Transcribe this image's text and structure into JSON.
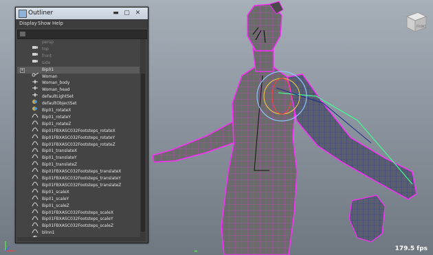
{
  "viewport": {
    "fps_text": "179.5 fps",
    "viewcube_label": "FRONT"
  },
  "outliner": {
    "title": "Outliner",
    "buttons": {
      "minimize": "▬",
      "maximize": "▢",
      "close": "✕"
    },
    "menu": [
      "Display",
      "Show",
      "Help"
    ],
    "items": [
      {
        "label": "persp",
        "icon": "camera-icon",
        "dim": true
      },
      {
        "label": "top",
        "icon": "camera-icon",
        "dim": true
      },
      {
        "label": "front",
        "icon": "camera-icon",
        "dim": true
      },
      {
        "label": "side",
        "icon": "camera-icon",
        "dim": true
      },
      {
        "label": "Bip01",
        "icon": "joint-icon",
        "selected": true,
        "expand": "+"
      },
      {
        "label": "Woman",
        "icon": "transform-icon"
      },
      {
        "label": "Woman_body",
        "icon": "transform-icon"
      },
      {
        "label": "Woman_head",
        "icon": "transform-icon"
      },
      {
        "label": "defaultLightSet",
        "icon": "set-icon"
      },
      {
        "label": "defaultObjectSet",
        "icon": "set-icon"
      },
      {
        "label": "Bip01_rotateX",
        "icon": "animcurve-icon"
      },
      {
        "label": "Bip01_rotateY",
        "icon": "animcurve-icon"
      },
      {
        "label": "Bip01_rotateZ",
        "icon": "animcurve-icon"
      },
      {
        "label": "Bip01FBXASC032Footsteps_rotateX",
        "icon": "animcurve-icon"
      },
      {
        "label": "Bip01FBXASC032Footsteps_rotateY",
        "icon": "animcurve-icon"
      },
      {
        "label": "Bip01FBXASC032Footsteps_rotateZ",
        "icon": "animcurve-icon"
      },
      {
        "label": "Bip01_translateX",
        "icon": "animcurve-icon"
      },
      {
        "label": "Bip01_translateY",
        "icon": "animcurve-icon"
      },
      {
        "label": "Bip01_translateZ",
        "icon": "animcurve-icon"
      },
      {
        "label": "Bip01FBXASC032Footsteps_translateX",
        "icon": "animcurve-icon"
      },
      {
        "label": "Bip01FBXASC032Footsteps_translateY",
        "icon": "animcurve-icon"
      },
      {
        "label": "Bip01FBXASC032Footsteps_translateZ",
        "icon": "animcurve-icon"
      },
      {
        "label": "Bip01_scaleX",
        "icon": "animcurve-icon"
      },
      {
        "label": "Bip01_scaleY",
        "icon": "animcurve-icon"
      },
      {
        "label": "Bip01_scaleZ",
        "icon": "animcurve-icon"
      },
      {
        "label": "Bip01FBXASC032Footsteps_scaleX",
        "icon": "animcurve-icon"
      },
      {
        "label": "Bip01FBXASC032Footsteps_scaleY",
        "icon": "animcurve-icon"
      },
      {
        "label": "Bip01FBXASC032Footsteps_scaleZ",
        "icon": "animcurve-icon"
      },
      {
        "label": "blinn1",
        "icon": "material-icon"
      }
    ]
  },
  "colors": {
    "wireframe": "#ff2cff",
    "mesh": "#6d6d6d",
    "selection_ring": "#ffd040",
    "bone_highlight": "#40ff90"
  }
}
